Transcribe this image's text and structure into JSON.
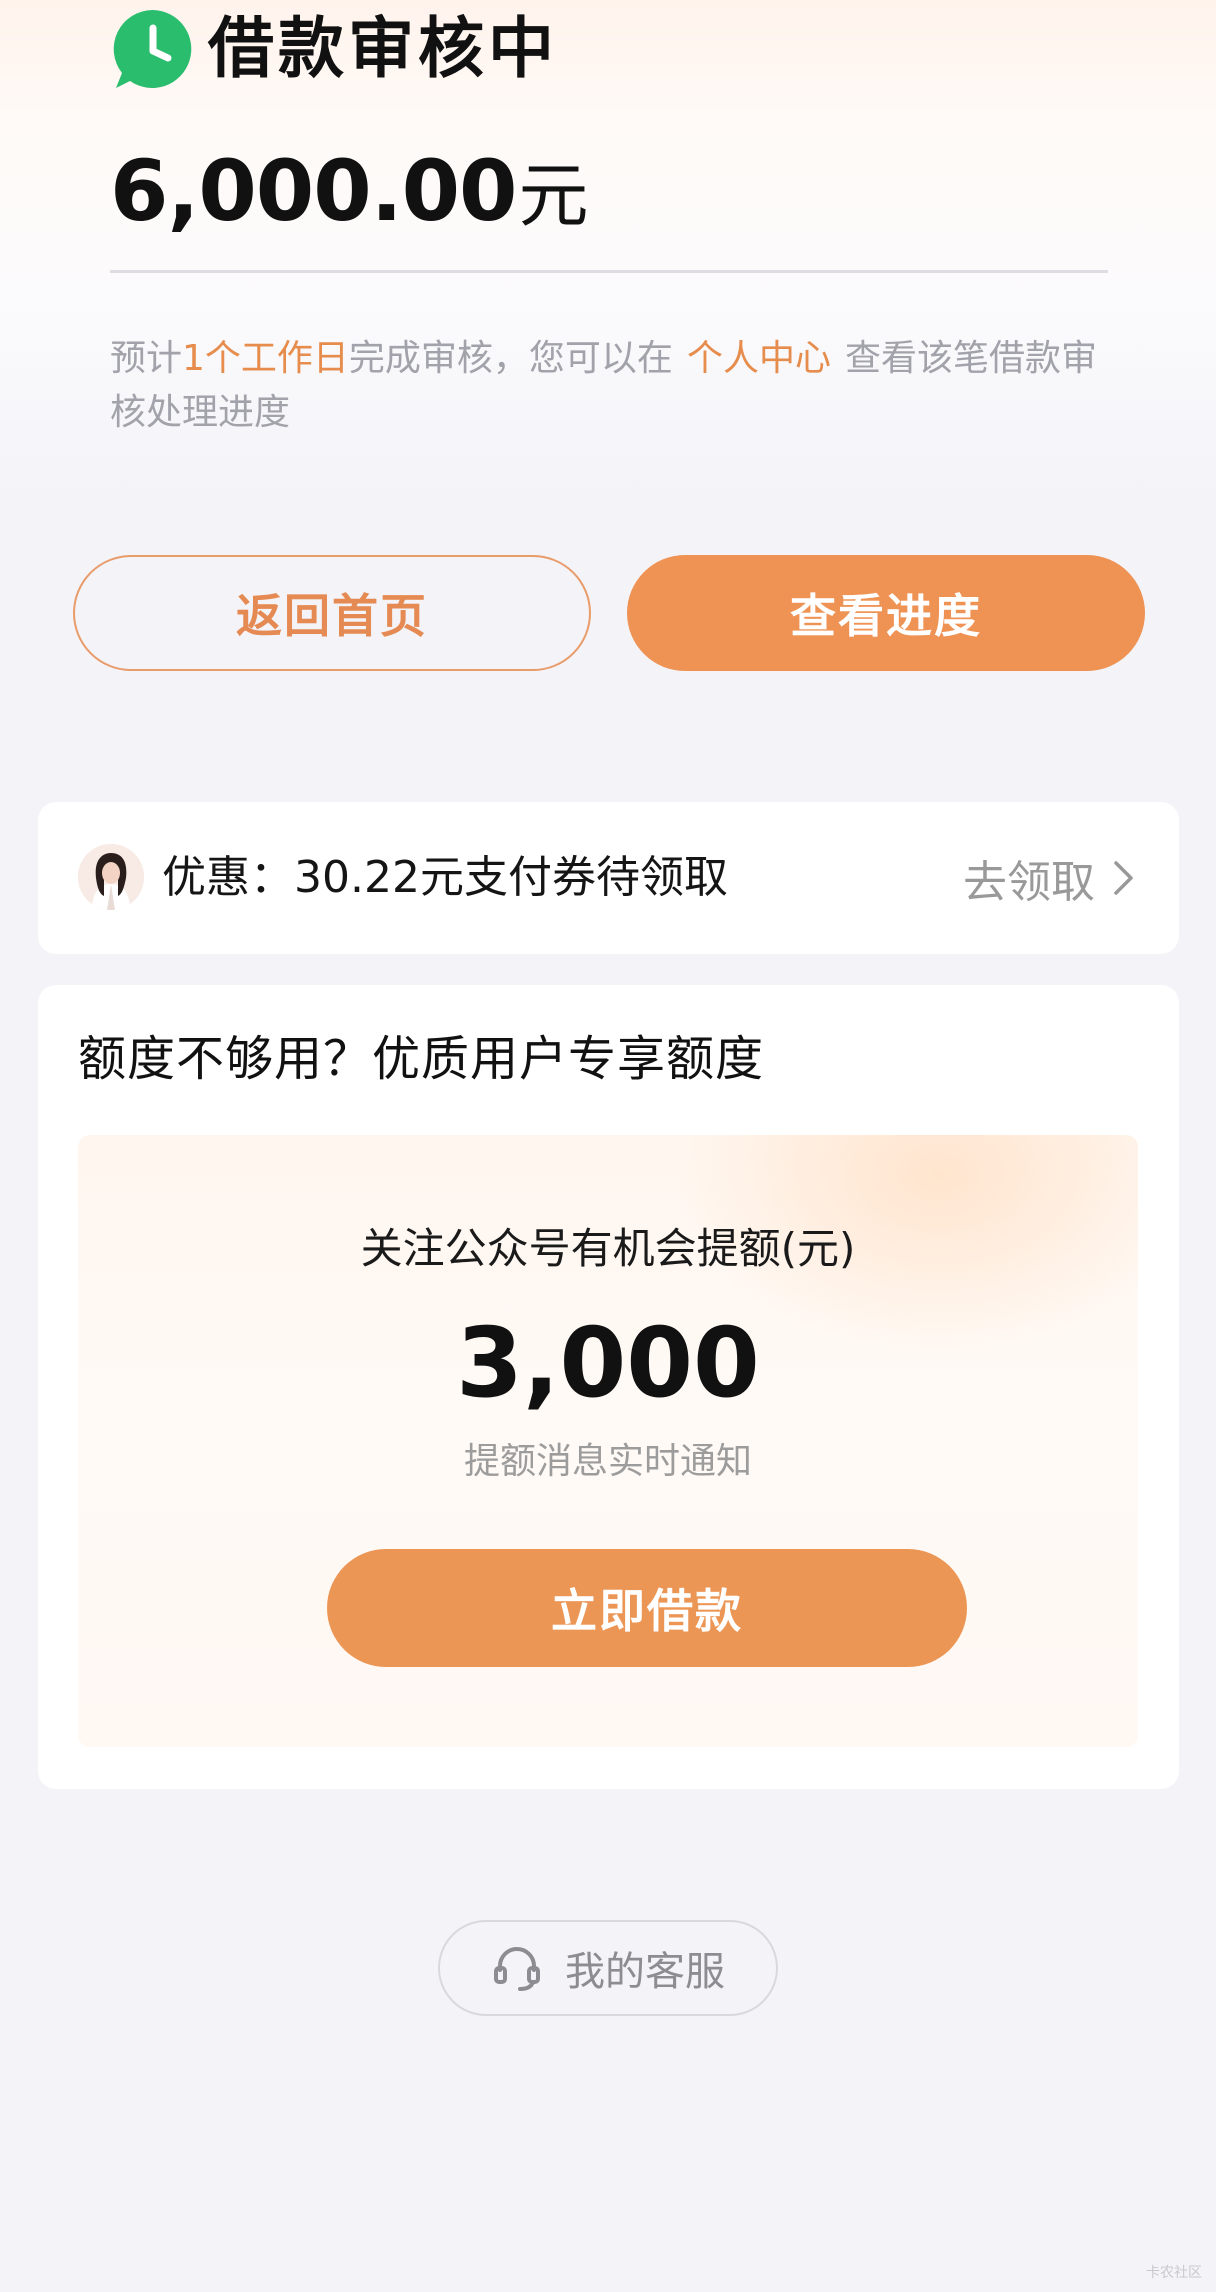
{
  "status": {
    "icon": "clock-icon",
    "title": "借款审核中"
  },
  "loan": {
    "amount": "6,000.00",
    "unit": "元"
  },
  "notice": {
    "part1": "预计",
    "highlight1": "1个工作日",
    "part2": "完成审核，您可以在",
    "highlight2": "个人中心",
    "part3": "查看该笔借款审核处理进度"
  },
  "buttons": {
    "home": "返回首页",
    "progress": "查看进度"
  },
  "coupon": {
    "text": "优惠：30.22元支付券待领取",
    "action": "去领取"
  },
  "quota": {
    "title": "额度不够用？优质用户专享额度",
    "heading": "关注公众号有机会提额(元)",
    "amount": "3,000",
    "subtitle": "提额消息实时通知",
    "button": "立即借款"
  },
  "service": {
    "label": "我的客服"
  },
  "watermark": "卡农社区",
  "colors": {
    "accent": "#ef9355",
    "highlight_text": "#e68c4c",
    "status_green": "#2bbd6e",
    "background": "#f3f3f8"
  }
}
